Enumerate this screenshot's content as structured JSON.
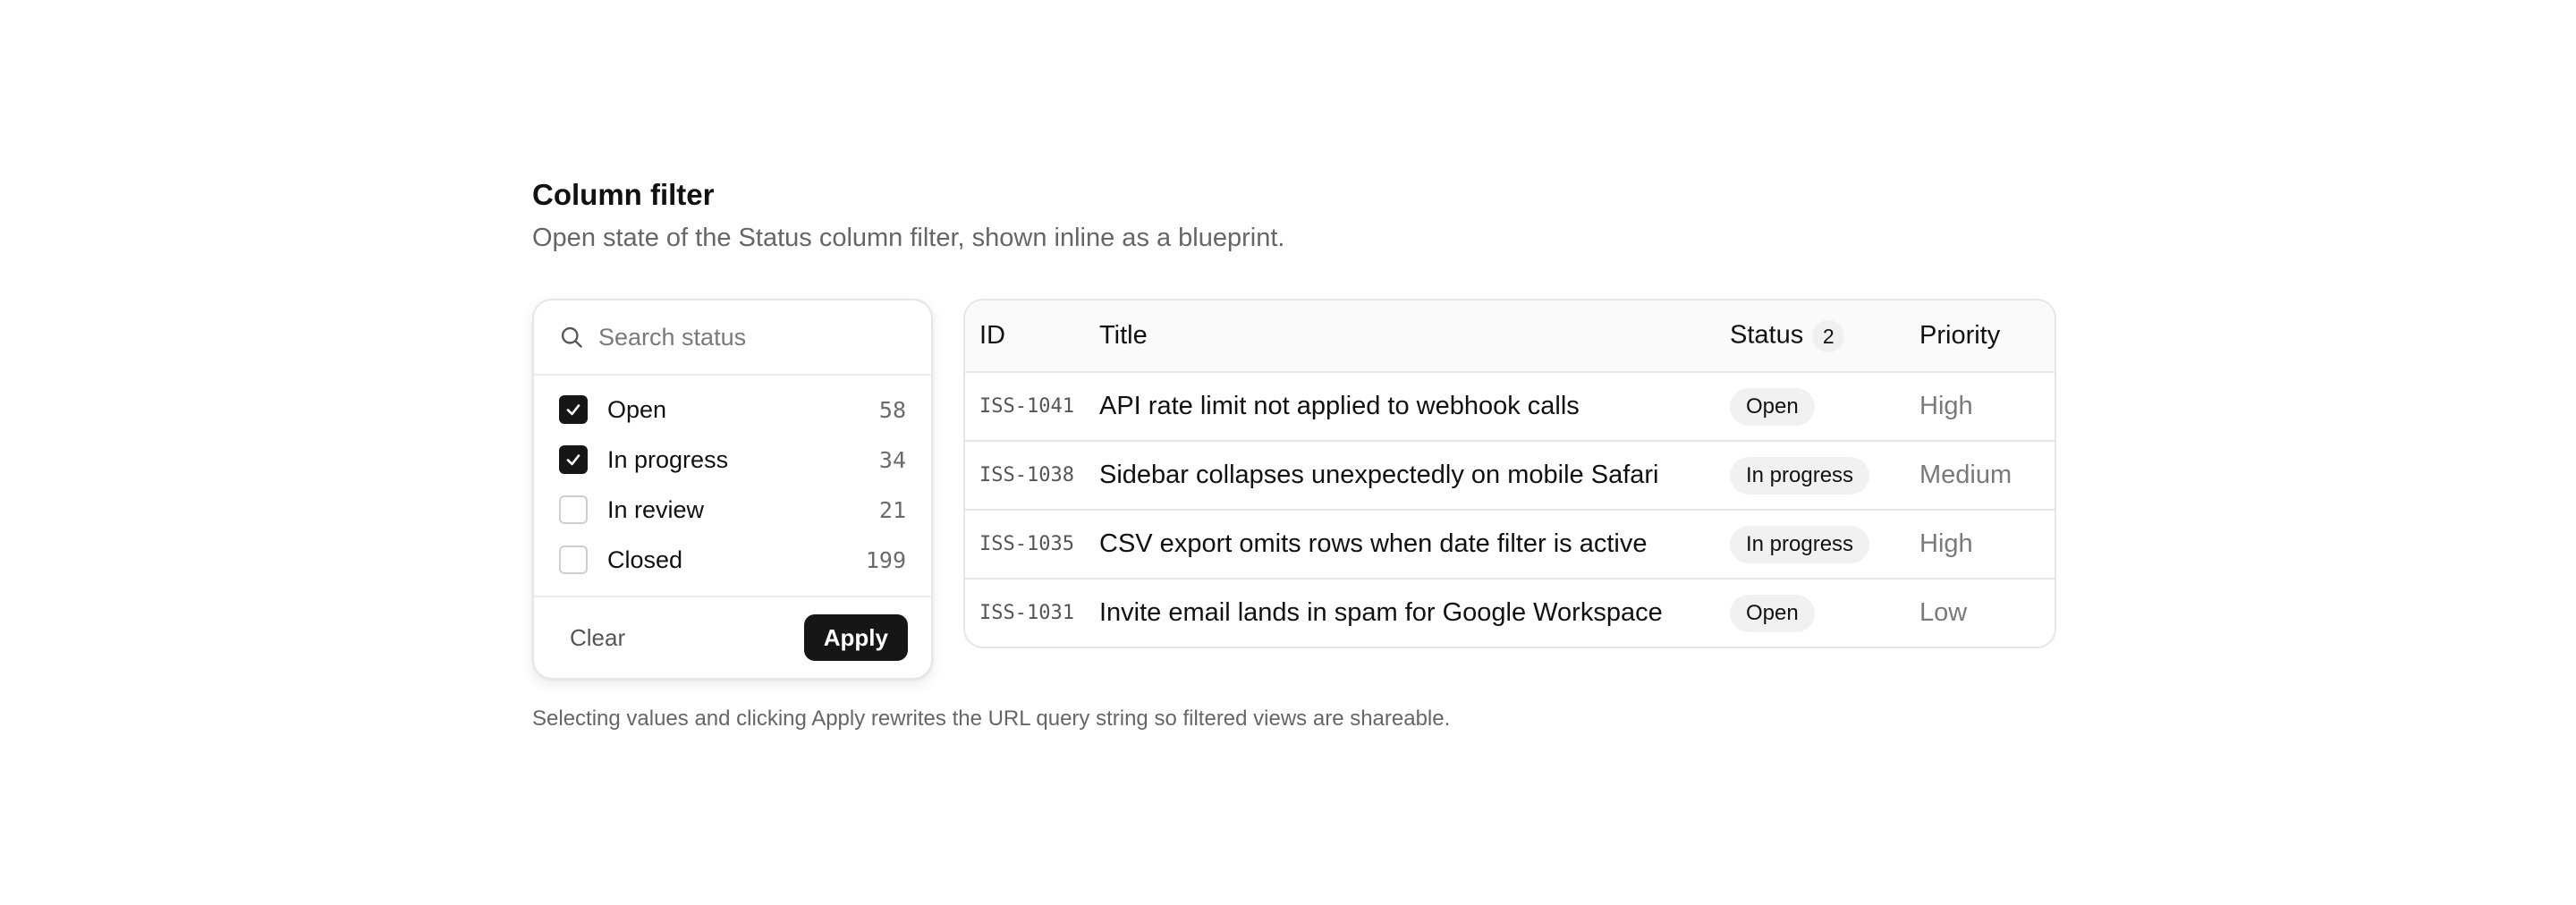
{
  "header": {
    "title": "Column filter",
    "subtitle": "Open state of the Status column filter, shown inline as a blueprint."
  },
  "filter": {
    "search_placeholder": "Search status",
    "search_icon": "search-icon",
    "options": [
      {
        "label": "Open",
        "count": "58",
        "checked": true
      },
      {
        "label": "In progress",
        "count": "34",
        "checked": true
      },
      {
        "label": "In review",
        "count": "21",
        "checked": false
      },
      {
        "label": "Closed",
        "count": "199",
        "checked": false
      }
    ],
    "clear_label": "Clear",
    "apply_label": "Apply"
  },
  "table": {
    "columns": {
      "id": "ID",
      "title": "Title",
      "status": "Status",
      "status_filter_count": "2",
      "priority": "Priority"
    },
    "rows": [
      {
        "id": "ISS-1041",
        "title": "API rate limit not applied to webhook calls",
        "status": "Open",
        "priority": "High"
      },
      {
        "id": "ISS-1038",
        "title": "Sidebar collapses unexpectedly on mobile Safari",
        "status": "In progress",
        "priority": "Medium"
      },
      {
        "id": "ISS-1035",
        "title": "CSV export omits rows when date filter is active",
        "status": "In progress",
        "priority": "High"
      },
      {
        "id": "ISS-1031",
        "title": "Invite email lands in spam for Google Workspace",
        "status": "Open",
        "priority": "Low"
      }
    ]
  },
  "footnote": "Selecting values and clicking Apply rewrites the URL query string so filtered views are shareable.",
  "colors": {
    "accent": "#161616",
    "border": "#e6e6e6",
    "muted": "#666666"
  }
}
